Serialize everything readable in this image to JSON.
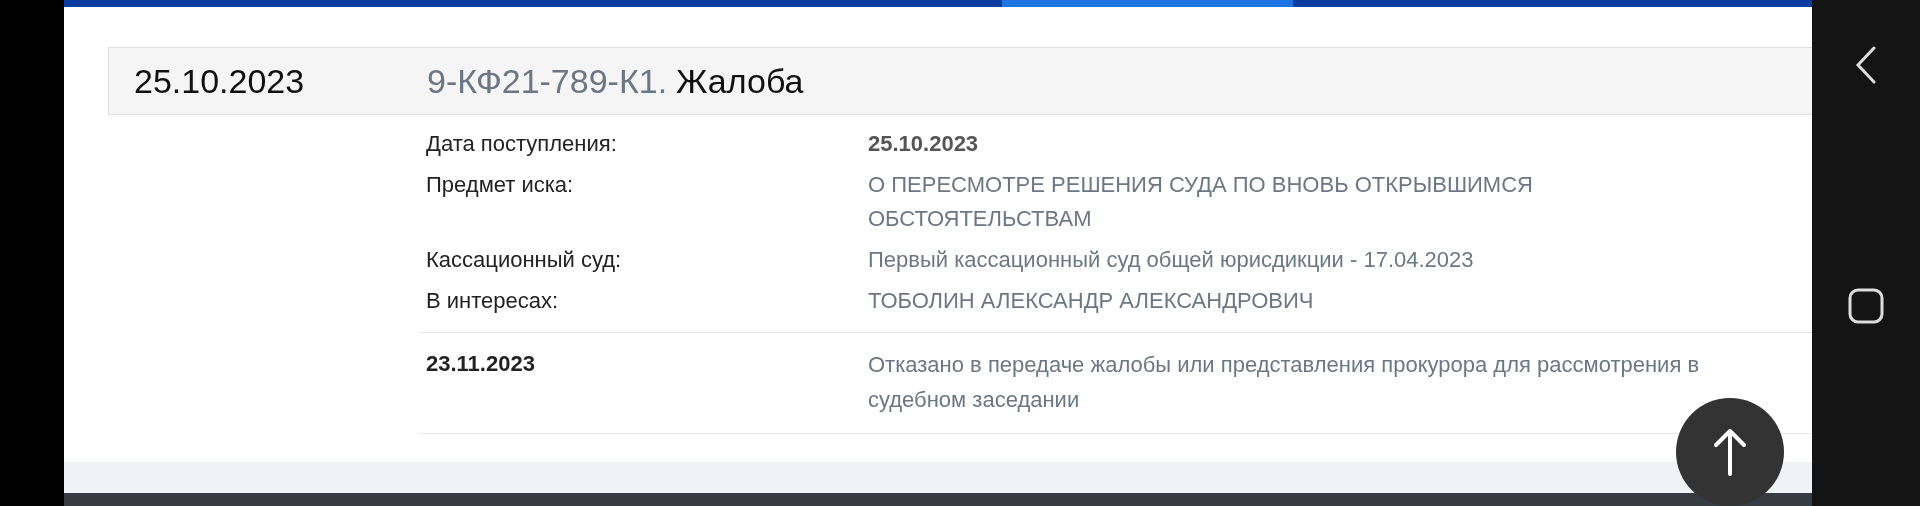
{
  "header": {
    "date": "25.10.2023",
    "case_number": "9-КФ21-789-К1.",
    "case_type": "Жалоба"
  },
  "details": [
    {
      "label": "Дата поступления:",
      "value": "25.10.2023",
      "kind": "strong"
    },
    {
      "label": "Предмет иска:",
      "value": "О ПЕРЕСМОТРЕ РЕШЕНИЯ СУДА ПО ВНОВЬ ОТКРЫВШИМСЯ ОБСТОЯТЕЛЬСТВАМ",
      "kind": "plain"
    },
    {
      "label": "Кассационный суд:",
      "value": "Первый кассационный суд общей юрисдикции - 17.04.2023",
      "kind": "plain"
    },
    {
      "label": "В интересах:",
      "value": "ТОБОЛИН АЛЕКСАНДР АЛЕКСАНДРОВИЧ",
      "kind": "plain"
    }
  ],
  "events": [
    {
      "date": "23.11.2023",
      "text": "Отказано в передаче жалобы или представления прокурора для рассмотрения в судебном заседании"
    }
  ]
}
